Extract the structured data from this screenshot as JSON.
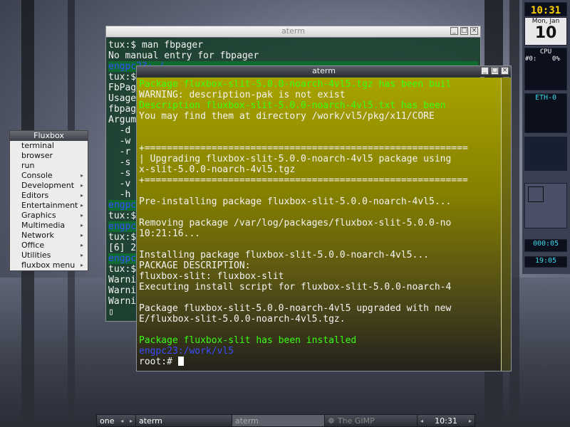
{
  "back_terminal": {
    "title": "aterm",
    "lines": [
      {
        "text": "tux:$ man fbpager",
        "cls": "w"
      },
      {
        "text": "No manual entry for fbpager",
        "cls": "w"
      },
      {
        "text": "engpc23:~/",
        "cls": "b"
      },
      {
        "text": "tux:$",
        "cls": "w"
      },
      {
        "text": "FbPag",
        "cls": "w"
      },
      {
        "text": "Usage",
        "cls": "w"
      },
      {
        "text": "fbpag",
        "cls": "w"
      },
      {
        "text": "Argum",
        "cls": "w"
      },
      {
        "text": "  -d",
        "cls": "w"
      },
      {
        "text": "  -w",
        "cls": "w"
      },
      {
        "text": "  -r",
        "cls": "w"
      },
      {
        "text": "  -s",
        "cls": "w"
      },
      {
        "text": "  -s",
        "cls": "w"
      },
      {
        "text": "  -v",
        "cls": "w"
      },
      {
        "text": "  -h",
        "cls": "w"
      },
      {
        "text": "engpc",
        "cls": "b"
      },
      {
        "text": "tux:$",
        "cls": "w"
      },
      {
        "text": "engpc",
        "cls": "b"
      },
      {
        "text": "tux:$",
        "cls": "w"
      },
      {
        "text": "[6] 2",
        "cls": "w"
      },
      {
        "text": "engpc",
        "cls": "b"
      },
      {
        "text": "tux:$",
        "cls": "w"
      },
      {
        "text": "Warni",
        "cls": "w"
      },
      {
        "text": "Warni",
        "cls": "w"
      },
      {
        "text": "Warni",
        "cls": "w"
      },
      {
        "text": "▯",
        "cls": "w"
      }
    ]
  },
  "front_terminal": {
    "title": "aterm",
    "lines": [
      {
        "text": "Package fluxbox-slit-5.0.0-noarch-4vl5.tgz has been buil",
        "cls": "g"
      },
      {
        "text": "WARNING: description-pak is not exist",
        "cls": "w"
      },
      {
        "text": "Description fluxbox-slit-5.0.0-noarch-4vl5.txt has been",
        "cls": "g"
      },
      {
        "text": "You may find them at directory /work/vl5/pkg/x11/CORE",
        "cls": "w"
      },
      {
        "text": "",
        "cls": "w"
      },
      {
        "text": "",
        "cls": "w"
      },
      {
        "text": "+==========================================================",
        "cls": "w"
      },
      {
        "text": "| Upgrading fluxbox-slit-5.0.0-noarch-4vl5 package using",
        "cls": "w"
      },
      {
        "text": "x-slit-5.0.0-noarch-4vl5.tgz",
        "cls": "w"
      },
      {
        "text": "+==========================================================",
        "cls": "w"
      },
      {
        "text": "",
        "cls": "w"
      },
      {
        "text": "Pre-installing package fluxbox-slit-5.0.0-noarch-4vl5...",
        "cls": "w"
      },
      {
        "text": "",
        "cls": "w"
      },
      {
        "text": "Removing package /var/log/packages/fluxbox-slit-5.0.0-no",
        "cls": "w"
      },
      {
        "text": "10:21:16...",
        "cls": "w"
      },
      {
        "text": "",
        "cls": "w"
      },
      {
        "text": "Installing package fluxbox-slit-5.0.0-noarch-4vl5...",
        "cls": "w"
      },
      {
        "text": "PACKAGE DESCRIPTION:",
        "cls": "w"
      },
      {
        "text": "fluxbox-slit: fluxbox-slit",
        "cls": "w"
      },
      {
        "text": "Executing install script for fluxbox-slit-5.0.0-noarch-4",
        "cls": "w"
      },
      {
        "text": "",
        "cls": "w"
      },
      {
        "text": "Package fluxbox-slit-5.0.0-noarch-4vl5 upgraded with new",
        "cls": "w"
      },
      {
        "text": "E/fluxbox-slit-5.0.0-noarch-4vl5.tgz.",
        "cls": "w"
      },
      {
        "text": "",
        "cls": "w"
      },
      {
        "text": "Package fluxbox-slit has been installed",
        "cls": "g"
      },
      {
        "text": "engpc23:/work/vl5",
        "cls": "b"
      }
    ],
    "prompt": "root:#"
  },
  "menu": {
    "title": "Fluxbox",
    "items": [
      {
        "label": "terminal",
        "sub": false
      },
      {
        "label": "browser",
        "sub": false
      },
      {
        "label": "run",
        "sub": false
      },
      {
        "label": "Console",
        "sub": true
      },
      {
        "label": "Development",
        "sub": true
      },
      {
        "label": "Editors",
        "sub": true
      },
      {
        "label": "Entertainment",
        "sub": true
      },
      {
        "label": "Graphics",
        "sub": true
      },
      {
        "label": "Multimedia",
        "sub": true
      },
      {
        "label": "Network",
        "sub": true
      },
      {
        "label": "Office",
        "sub": true
      },
      {
        "label": "Utilities",
        "sub": true
      },
      {
        "label": "fluxbox menu",
        "sub": true
      }
    ]
  },
  "slit": {
    "clock": "10:31",
    "cal_day": "Mon, Jan",
    "cal_date": "10",
    "cpu_label": "CPU",
    "cpu_value": "#0:    0%",
    "net_label": "ETH-0",
    "uptime": "000:05",
    "time2": "19:05"
  },
  "taskbar": {
    "workspace": "one",
    "task1": "aterm",
    "task2": "aterm",
    "task3": "The GIMP",
    "clock": "10:31"
  },
  "icons": [
    "minimize-icon",
    "maximize-icon",
    "close-icon",
    "submenu-arrow-icon",
    "left-arrow-icon",
    "right-arrow-icon"
  ]
}
